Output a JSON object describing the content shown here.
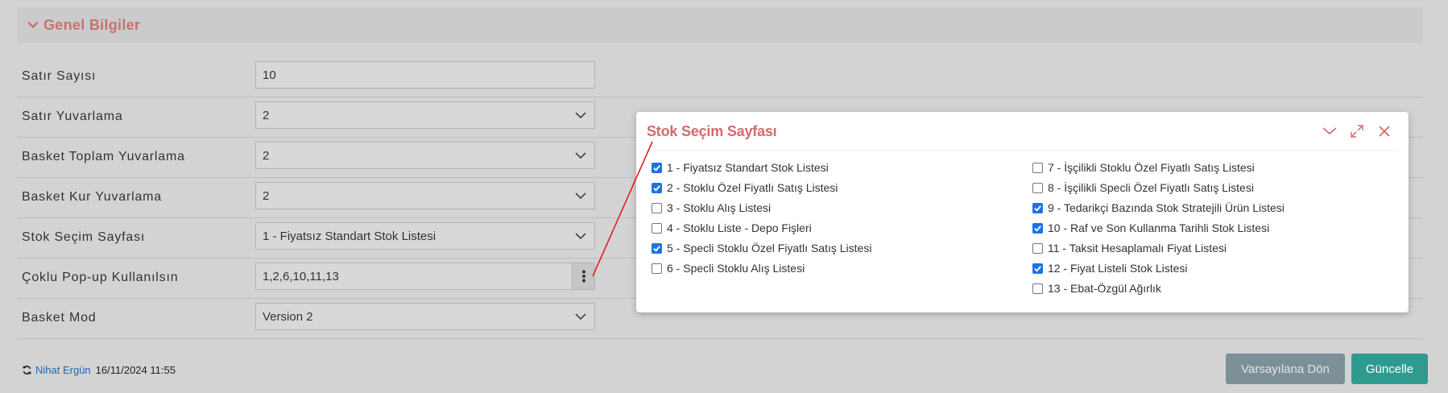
{
  "section": {
    "title": "Genel Bilgiler",
    "collapse_icon": "chevron-down-icon"
  },
  "form": {
    "rows": [
      {
        "label": "Satır Sayısı",
        "value": "10",
        "type": "text"
      },
      {
        "label": "Satır Yuvarlama",
        "value": "2",
        "type": "select"
      },
      {
        "label": "Basket Toplam Yuvarlama",
        "value": "2",
        "type": "select"
      },
      {
        "label": "Basket Kur Yuvarlama",
        "value": "2",
        "type": "select"
      },
      {
        "label": "Stok Seçim Sayfası",
        "value": "1 - Fiyatsız Standart Stok Listesi",
        "type": "select"
      },
      {
        "label": "Çoklu Pop-up Kullanılsın",
        "value": "1,2,6,10,11,13",
        "type": "multi"
      },
      {
        "label": "Basket Mod",
        "value": "Version 2",
        "type": "select"
      }
    ]
  },
  "footer": {
    "user": "Nihat Ergün",
    "date": "16/11/2024 11:55",
    "reset_label": "Varsayılana Dön",
    "update_label": "Güncelle"
  },
  "modal": {
    "title": "Stok Seçim Sayfası",
    "options_left": [
      {
        "label": "1 - Fiyatsız Standart Stok Listesi",
        "checked": true
      },
      {
        "label": "2 - Stoklu Özel Fiyatlı Satış Listesi",
        "checked": true
      },
      {
        "label": "3 - Stoklu Alış Listesi",
        "checked": false
      },
      {
        "label": "4 - Stoklu Liste - Depo Fişleri",
        "checked": false
      },
      {
        "label": "5 - Specli Stoklu Özel Fiyatlı Satış Listesi",
        "checked": true
      },
      {
        "label": "6 - Specli Stoklu Alış Listesi",
        "checked": false
      }
    ],
    "options_right": [
      {
        "label": "7 - İşçilikli Stoklu Özel Fiyatlı Satış Listesi",
        "checked": false
      },
      {
        "label": "8 - İşçilikli Specli Özel Fiyatlı Satış Listesi",
        "checked": false
      },
      {
        "label": "9 - Tedarikçi Bazında Stok Stratejili Ürün Listesi",
        "checked": true
      },
      {
        "label": "10 - Raf ve Son Kullanma Tarihli Stok Listesi",
        "checked": true
      },
      {
        "label": "11 - Taksit Hesaplamalı Fiyat Listesi",
        "checked": false
      },
      {
        "label": "12 - Fiyat Listeli Stok Listesi",
        "checked": true
      },
      {
        "label": "13 - Ebat-Özgül Ağırlık",
        "checked": false
      }
    ]
  },
  "colors": {
    "accent_red": "#d46a6a",
    "link_blue": "#1e64b4",
    "checkbox_blue": "#1a73e8",
    "update_button": "#2f9a8f",
    "reset_button": "#7d9098"
  }
}
